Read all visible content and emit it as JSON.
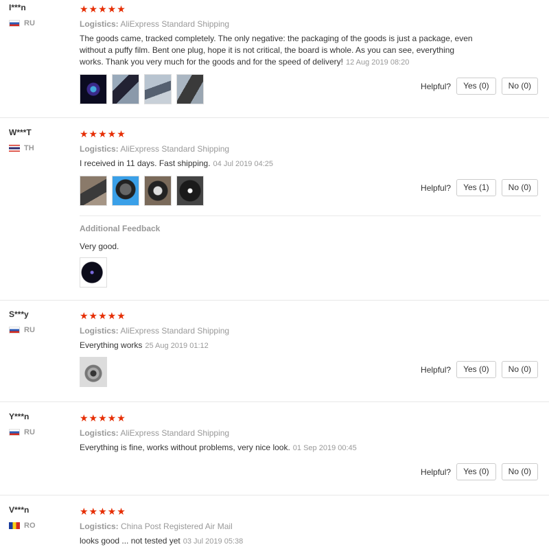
{
  "labels": {
    "logistics": "Logistics:",
    "helpful": "Helpful?",
    "additional_feedback": "Additional Feedback"
  },
  "reviews": [
    {
      "author": "I***n",
      "country": "RU",
      "stars": "★★★★★",
      "shipping": "AliExpress Standard Shipping",
      "text": "The goods came, tracked completely. The only negative: the packaging of the goods is just a package, even without a puffy film. Bent one plug, hope it is not critical, the board is whole. As you can see, everything works. Thank you very much for the goods and for the speed of delivery!",
      "date": "12 Aug 2019 08:20",
      "yes": "Yes (0)",
      "no": "No (0)"
    },
    {
      "author": "W***T",
      "country": "TH",
      "stars": "★★★★★",
      "shipping": "AliExpress Standard Shipping",
      "text": "I received in 11 days. Fast shipping.",
      "date": "04 Jul 2019 04:25",
      "yes": "Yes (1)",
      "no": "No (0)",
      "additional": "Very good."
    },
    {
      "author": "S***y",
      "country": "RU",
      "stars": "★★★★★",
      "shipping": "AliExpress Standard Shipping",
      "text": "Everything works",
      "date": "25 Aug 2019 01:12",
      "yes": "Yes (0)",
      "no": "No (0)"
    },
    {
      "author": "Y***n",
      "country": "RU",
      "stars": "★★★★★",
      "shipping": "AliExpress Standard Shipping",
      "text": "Everything is fine, works without problems, very nice look.",
      "date": "01 Sep 2019 00:45",
      "yes": "Yes (0)",
      "no": "No (0)"
    },
    {
      "author": "V***n",
      "country": "RO",
      "stars": "★★★★★",
      "shipping": "China Post Registered Air Mail",
      "text": "looks good ... not tested yet",
      "date": "03 Jul 2019 05:38"
    }
  ],
  "colors": {
    "star": "#e62e04",
    "muted": "#999999",
    "divider": "#e8e8e8"
  }
}
